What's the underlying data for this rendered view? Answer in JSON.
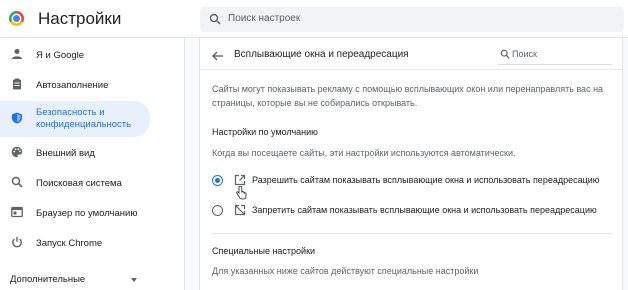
{
  "app": {
    "title": "Настройки",
    "search_placeholder": "Поиск настроек"
  },
  "sidebar": {
    "items": [
      {
        "label": "Я и Google",
        "icon": "person-icon"
      },
      {
        "label": "Автозаполнение",
        "icon": "clipboard-icon"
      },
      {
        "label": "Безопасность и конфиденциальность",
        "icon": "shield-icon",
        "active": true
      },
      {
        "label": "Внешний вид",
        "icon": "palette-icon"
      },
      {
        "label": "Поисковая система",
        "icon": "search-icon"
      },
      {
        "label": "Браузер по умолчанию",
        "icon": "browser-icon"
      },
      {
        "label": "Запуск Chrome",
        "icon": "power-icon"
      }
    ],
    "more_label": "Дополнительные"
  },
  "page": {
    "title": "Всплывающие окна и переадресация",
    "search_placeholder": "Поиск",
    "description": "Сайты могут показывать рекламу с помощью всплывающих окон или перенаправлять вас на страницы, которые вы не собирались открывать.",
    "default_section": {
      "heading": "Настройки по умолчанию",
      "subtext": "Когда вы посещаете сайты, эти настройки используются автоматически.",
      "options": [
        {
          "label": "Разрешить сайтам показывать всплывающие окна и использовать переадресацию",
          "checked": true,
          "icon": "open-in-new-icon"
        },
        {
          "label": "Запретить сайтам показывать всплывающие окна и использовать переадресацию",
          "checked": false,
          "icon": "popup-blocked-icon"
        }
      ]
    },
    "custom_section": {
      "heading": "Специальные настройки",
      "subtext": "Для указанных ниже сайтов действуют специальные настройки"
    }
  },
  "colors": {
    "accent": "#1a73e8",
    "active_bg": "#e8f0fe",
    "text": "#202124",
    "secondary_text": "#5f6368"
  }
}
